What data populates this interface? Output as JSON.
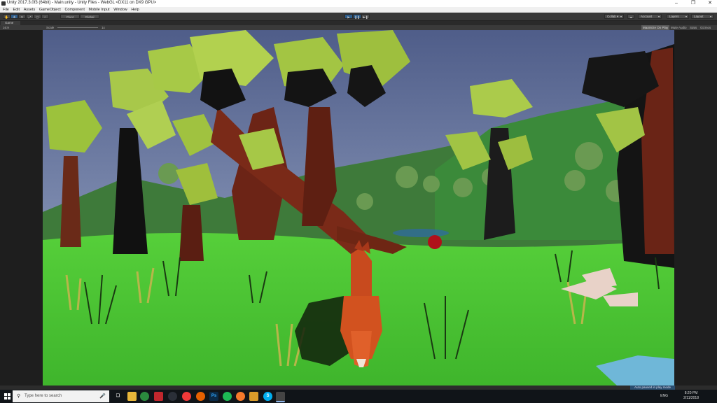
{
  "window": {
    "title": "Unity 2017.3.0f3 (64bit) - Main.unity - Unity Files - WebGL <DX11 on DX9 GPU>",
    "minimize": "–",
    "restore": "❐",
    "close": "✕"
  },
  "menu": [
    "File",
    "Edit",
    "Assets",
    "GameObject",
    "Component",
    "Mobile Input",
    "Window",
    "Help"
  ],
  "toolbar": {
    "pivot": "Pivot",
    "global": "Global",
    "collab": "Collab ▾",
    "account": "Account",
    "layers": "Layers",
    "layout": "Layout"
  },
  "game_tab": {
    "label": "Game",
    "display": "16:9",
    "scale_label": "Scale",
    "scale_value": "1x",
    "maximize_on_play": "Maximize On Play",
    "mute_audio": "Mute Audio",
    "stats": "Stats",
    "gizmos": "Gizmos"
  },
  "status_message": "Auto paused in play mode",
  "taskbar": {
    "search_placeholder": "Type here to search",
    "language": "ENG",
    "time": "8:20 PM",
    "date": "2/11/2018"
  },
  "icons": [
    "windows-start-icon",
    "search-icon",
    "microphone-icon",
    "task-view-icon",
    "file-explorer-icon",
    "chrome-icon",
    "app-icon",
    "steam-icon",
    "vivaldi-icon",
    "firefox-icon",
    "photoshop-icon",
    "spotify-icon",
    "blender-icon",
    "folder-icon",
    "skype-icon",
    "unity-icon"
  ],
  "colors": {
    "play_button": "#2d5c8a",
    "sky": "#6f80a8",
    "grass": "#4cc838"
  }
}
